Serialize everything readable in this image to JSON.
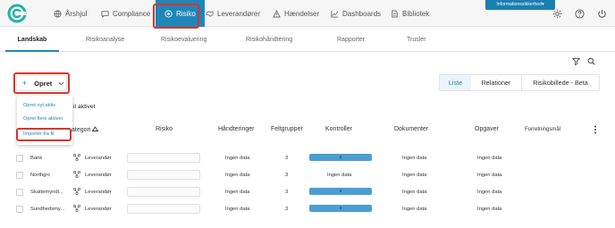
{
  "topbar": {
    "nav": [
      {
        "label": "Årshjul",
        "icon": "globe-icon"
      },
      {
        "label": "Compliance",
        "icon": "chat-icon"
      },
      {
        "label": "Risiko",
        "icon": "target-icon"
      },
      {
        "label": "Leverandører",
        "icon": "handshake-icon"
      },
      {
        "label": "Hændelser",
        "icon": "warning-icon"
      },
      {
        "label": "Dashboards",
        "icon": "chart-icon"
      },
      {
        "label": "Bibliotek",
        "icon": "document-icon"
      }
    ],
    "badge": "Informationssikkerhed",
    "accent": "#1f86b8",
    "highlight": "#d9352c"
  },
  "subtabs": [
    "Landskab",
    "Risikoanalyse",
    "Risikoevaluering",
    "Risikohåndtering",
    "Rapporter",
    "Trusler"
  ],
  "opret": {
    "plus": "+",
    "label": "Opret",
    "menu": [
      "Opret nyt aktiv",
      "Opret flere aktiver",
      "Importér fra fil"
    ]
  },
  "partial_text": "il aktivet",
  "views": [
    "Liste",
    "Relationer",
    "Risikobillede - Beta"
  ],
  "table": {
    "headers": [
      "ategori",
      "Risiko",
      "Håndteringer",
      "Feltgrupper",
      "Kontroller",
      "Dokumenter",
      "Opgaver",
      "Forretningsmål"
    ],
    "rows": [
      {
        "name": "Bank",
        "category": "Leverandør",
        "handling": "Ingen data",
        "fields": "3",
        "controls": "6",
        "documents": "Ingen data",
        "tasks": "Ingen data"
      },
      {
        "name": "Northgrc",
        "category": "Leverandør",
        "handling": "Ingen data",
        "fields": "3",
        "controls": "Ingen data",
        "documents": "Ingen data",
        "tasks": "Ingen data"
      },
      {
        "name": "Skattemyndi...",
        "category": "Leverandør",
        "handling": "Ingen data",
        "fields": "3",
        "controls": "6",
        "documents": "Ingen data",
        "tasks": "Ingen data"
      },
      {
        "name": "Sundhedsmy...",
        "category": "Leverandør",
        "handling": "Ingen data",
        "fields": "3",
        "controls": "6",
        "documents": "Ingen data",
        "tasks": "Ingen data"
      }
    ]
  }
}
